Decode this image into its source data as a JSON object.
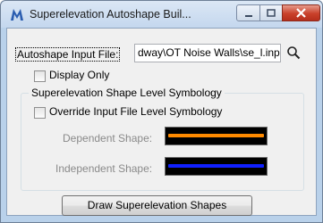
{
  "window": {
    "title": "Superelevation Autoshape Buil...",
    "app_icon": "bentley-m-icon",
    "controls": {
      "minimize": "minimize-icon",
      "maximize": "maximize-icon",
      "close": "close-icon"
    }
  },
  "form": {
    "input_file_label": "Autoshape Input File:",
    "input_file_value": "dway\\OT Noise Walls\\se_l.inp",
    "browse_icon": "search-icon",
    "display_only_label": "Display Only",
    "display_only_checked": false
  },
  "symbology": {
    "group_title": "Superelevation Shape Level Symbology",
    "override_label": "Override Input File Level Symbology",
    "override_checked": false,
    "dependent_label": "Dependent Shape:",
    "dependent_color": "#ff8a00",
    "independent_label": "Independent Shape:",
    "independent_color": "#1020ff"
  },
  "actions": {
    "draw_label": "Draw Superelevation Shapes"
  }
}
